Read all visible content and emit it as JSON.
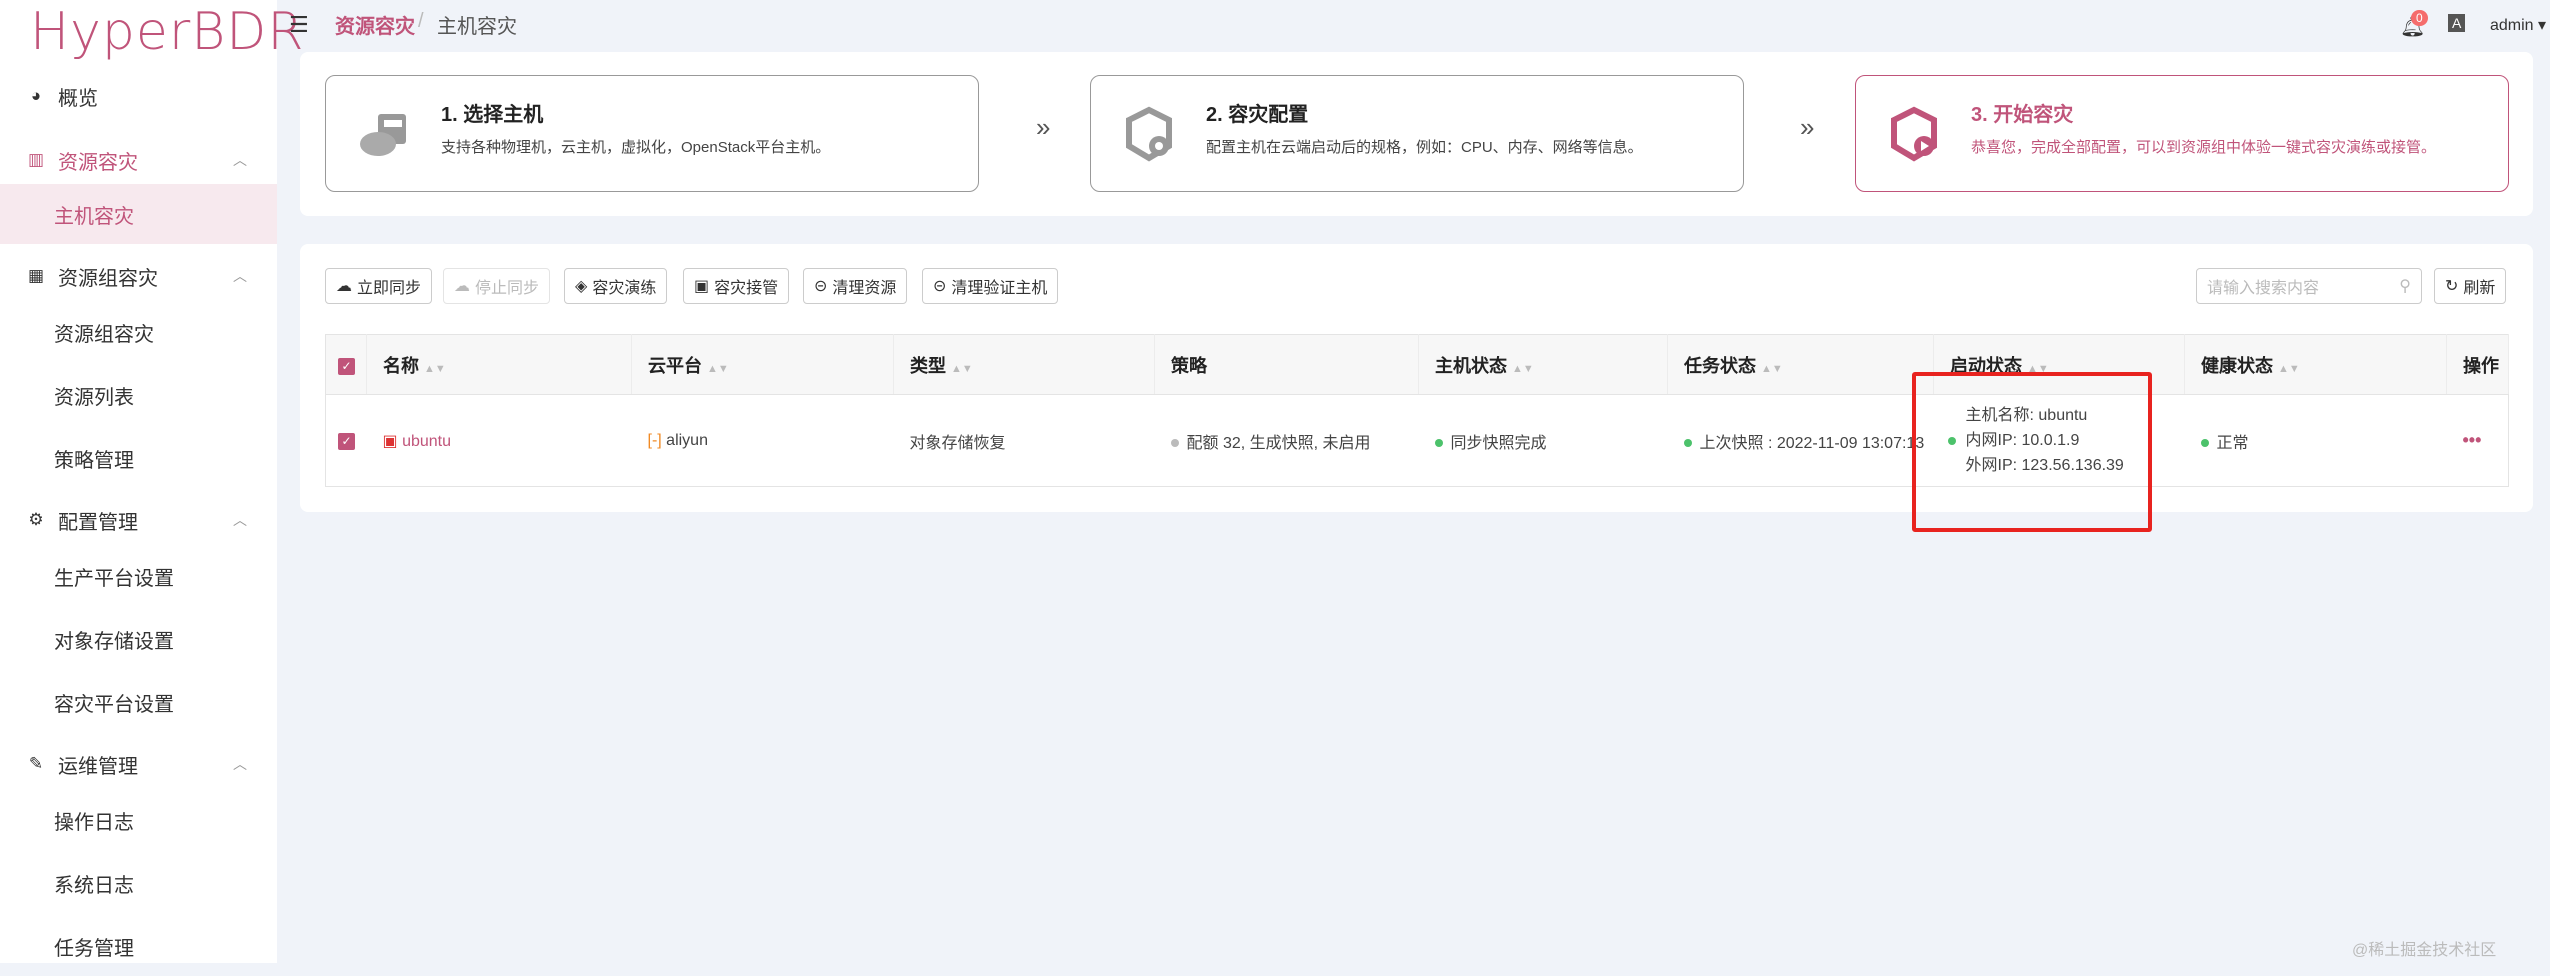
{
  "app": {
    "logo": "HyperBDR",
    "accent": "#c0547a"
  },
  "sidebar": {
    "items": [
      {
        "label": "概览",
        "icon": "dashboard-icon"
      },
      {
        "label": "资源容灾",
        "icon": "building-icon"
      },
      {
        "label": "主机容灾"
      },
      {
        "label": "资源组容灾",
        "icon": "bank-icon"
      },
      {
        "label": "资源组容灾"
      },
      {
        "label": "资源列表"
      },
      {
        "label": "策略管理"
      },
      {
        "label": "配置管理",
        "icon": "gears-icon"
      },
      {
        "label": "生产平台设置"
      },
      {
        "label": "对象存储设置"
      },
      {
        "label": "容灾平台设置"
      },
      {
        "label": "运维管理",
        "icon": "tools-icon"
      },
      {
        "label": "操作日志"
      },
      {
        "label": "系统日志"
      },
      {
        "label": "任务管理"
      }
    ]
  },
  "header": {
    "breadcrumb": [
      "资源容灾",
      "主机容灾"
    ],
    "separator": "/",
    "notifications": "0",
    "user": "admin"
  },
  "steps": [
    {
      "title": "1. 选择主机",
      "desc": "支持各种物理机，云主机，虚拟化，OpenStack平台主机。"
    },
    {
      "title": "2. 容灾配置",
      "desc": "配置主机在云端启动后的规格，例如：CPU、内存、网络等信息。"
    },
    {
      "title": "3. 开始容灾",
      "desc": "恭喜您，完成全部配置，可以到资源组中体验一键式容灾演练或接管。"
    }
  ],
  "toolbar": {
    "buttons": [
      "立即同步",
      "停止同步",
      "容灾演练",
      "容灾接管",
      "清理资源",
      "清理验证主机"
    ],
    "search_placeholder": "请输入搜索内容",
    "refresh": "刷新"
  },
  "table": {
    "headers": [
      "名称",
      "云平台",
      "类型",
      "策略",
      "主机状态",
      "任务状态",
      "启动状态",
      "健康状态",
      "操作"
    ],
    "rows": [
      {
        "name": "ubuntu",
        "platform": "aliyun",
        "type": "对象存储恢复",
        "strategy": "配额 32, 生成快照, 未启用",
        "host_status": "同步快照完成",
        "task_status": "上次快照 : 2022-11-09 13:07:13",
        "boot_hostname": "主机名称: ubuntu",
        "boot_private_ip": "内网IP: 10.0.1.9",
        "boot_public_ip": "外网IP: 123.56.136.39",
        "health": "正常",
        "ops": "•••"
      }
    ]
  },
  "watermark": "@稀土掘金技术社区"
}
